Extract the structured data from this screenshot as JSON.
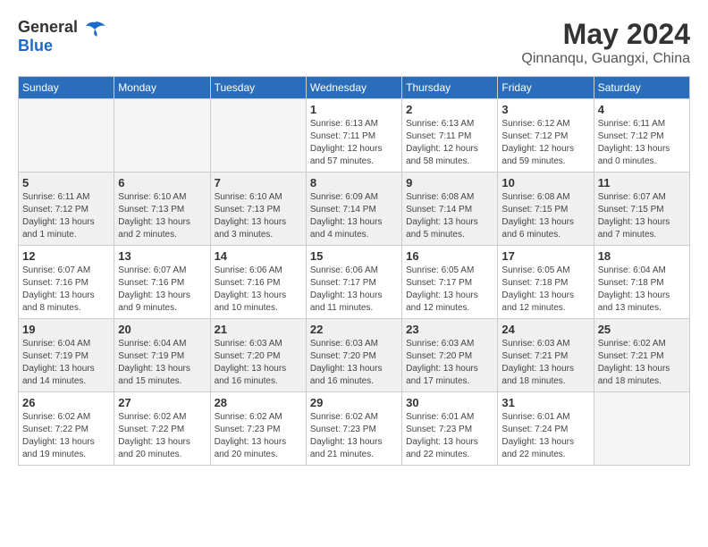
{
  "header": {
    "logo_general": "General",
    "logo_blue": "Blue",
    "month": "May 2024",
    "location": "Qinnanqu, Guangxi, China"
  },
  "weekdays": [
    "Sunday",
    "Monday",
    "Tuesday",
    "Wednesday",
    "Thursday",
    "Friday",
    "Saturday"
  ],
  "weeks": [
    [
      {
        "day": "",
        "info": ""
      },
      {
        "day": "",
        "info": ""
      },
      {
        "day": "",
        "info": ""
      },
      {
        "day": "1",
        "info": "Sunrise: 6:13 AM\nSunset: 7:11 PM\nDaylight: 12 hours\nand 57 minutes."
      },
      {
        "day": "2",
        "info": "Sunrise: 6:13 AM\nSunset: 7:11 PM\nDaylight: 12 hours\nand 58 minutes."
      },
      {
        "day": "3",
        "info": "Sunrise: 6:12 AM\nSunset: 7:12 PM\nDaylight: 12 hours\nand 59 minutes."
      },
      {
        "day": "4",
        "info": "Sunrise: 6:11 AM\nSunset: 7:12 PM\nDaylight: 13 hours\nand 0 minutes."
      }
    ],
    [
      {
        "day": "5",
        "info": "Sunrise: 6:11 AM\nSunset: 7:12 PM\nDaylight: 13 hours\nand 1 minute."
      },
      {
        "day": "6",
        "info": "Sunrise: 6:10 AM\nSunset: 7:13 PM\nDaylight: 13 hours\nand 2 minutes."
      },
      {
        "day": "7",
        "info": "Sunrise: 6:10 AM\nSunset: 7:13 PM\nDaylight: 13 hours\nand 3 minutes."
      },
      {
        "day": "8",
        "info": "Sunrise: 6:09 AM\nSunset: 7:14 PM\nDaylight: 13 hours\nand 4 minutes."
      },
      {
        "day": "9",
        "info": "Sunrise: 6:08 AM\nSunset: 7:14 PM\nDaylight: 13 hours\nand 5 minutes."
      },
      {
        "day": "10",
        "info": "Sunrise: 6:08 AM\nSunset: 7:15 PM\nDaylight: 13 hours\nand 6 minutes."
      },
      {
        "day": "11",
        "info": "Sunrise: 6:07 AM\nSunset: 7:15 PM\nDaylight: 13 hours\nand 7 minutes."
      }
    ],
    [
      {
        "day": "12",
        "info": "Sunrise: 6:07 AM\nSunset: 7:16 PM\nDaylight: 13 hours\nand 8 minutes."
      },
      {
        "day": "13",
        "info": "Sunrise: 6:07 AM\nSunset: 7:16 PM\nDaylight: 13 hours\nand 9 minutes."
      },
      {
        "day": "14",
        "info": "Sunrise: 6:06 AM\nSunset: 7:16 PM\nDaylight: 13 hours\nand 10 minutes."
      },
      {
        "day": "15",
        "info": "Sunrise: 6:06 AM\nSunset: 7:17 PM\nDaylight: 13 hours\nand 11 minutes."
      },
      {
        "day": "16",
        "info": "Sunrise: 6:05 AM\nSunset: 7:17 PM\nDaylight: 13 hours\nand 12 minutes."
      },
      {
        "day": "17",
        "info": "Sunrise: 6:05 AM\nSunset: 7:18 PM\nDaylight: 13 hours\nand 12 minutes."
      },
      {
        "day": "18",
        "info": "Sunrise: 6:04 AM\nSunset: 7:18 PM\nDaylight: 13 hours\nand 13 minutes."
      }
    ],
    [
      {
        "day": "19",
        "info": "Sunrise: 6:04 AM\nSunset: 7:19 PM\nDaylight: 13 hours\nand 14 minutes."
      },
      {
        "day": "20",
        "info": "Sunrise: 6:04 AM\nSunset: 7:19 PM\nDaylight: 13 hours\nand 15 minutes."
      },
      {
        "day": "21",
        "info": "Sunrise: 6:03 AM\nSunset: 7:20 PM\nDaylight: 13 hours\nand 16 minutes."
      },
      {
        "day": "22",
        "info": "Sunrise: 6:03 AM\nSunset: 7:20 PM\nDaylight: 13 hours\nand 16 minutes."
      },
      {
        "day": "23",
        "info": "Sunrise: 6:03 AM\nSunset: 7:20 PM\nDaylight: 13 hours\nand 17 minutes."
      },
      {
        "day": "24",
        "info": "Sunrise: 6:03 AM\nSunset: 7:21 PM\nDaylight: 13 hours\nand 18 minutes."
      },
      {
        "day": "25",
        "info": "Sunrise: 6:02 AM\nSunset: 7:21 PM\nDaylight: 13 hours\nand 18 minutes."
      }
    ],
    [
      {
        "day": "26",
        "info": "Sunrise: 6:02 AM\nSunset: 7:22 PM\nDaylight: 13 hours\nand 19 minutes."
      },
      {
        "day": "27",
        "info": "Sunrise: 6:02 AM\nSunset: 7:22 PM\nDaylight: 13 hours\nand 20 minutes."
      },
      {
        "day": "28",
        "info": "Sunrise: 6:02 AM\nSunset: 7:23 PM\nDaylight: 13 hours\nand 20 minutes."
      },
      {
        "day": "29",
        "info": "Sunrise: 6:02 AM\nSunset: 7:23 PM\nDaylight: 13 hours\nand 21 minutes."
      },
      {
        "day": "30",
        "info": "Sunrise: 6:01 AM\nSunset: 7:23 PM\nDaylight: 13 hours\nand 22 minutes."
      },
      {
        "day": "31",
        "info": "Sunrise: 6:01 AM\nSunset: 7:24 PM\nDaylight: 13 hours\nand 22 minutes."
      },
      {
        "day": "",
        "info": ""
      }
    ]
  ]
}
